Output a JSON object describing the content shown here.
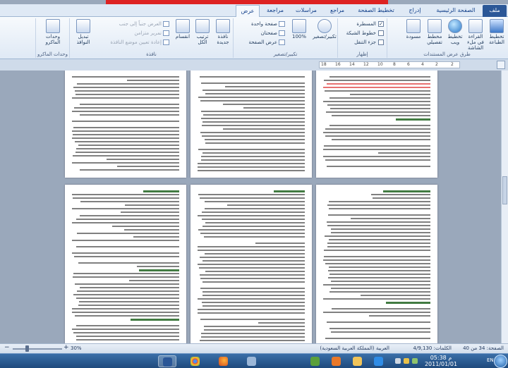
{
  "tabs": [
    {
      "id": "file",
      "label": "ملف"
    },
    {
      "id": "home",
      "label": "الصفحة الرئيسية"
    },
    {
      "id": "insert",
      "label": "إدراج"
    },
    {
      "id": "layout",
      "label": "تخطيط الصفحة"
    },
    {
      "id": "references",
      "label": "مراجع"
    },
    {
      "id": "mailings",
      "label": "مراسلات"
    },
    {
      "id": "review",
      "label": "مراجعة"
    },
    {
      "id": "view",
      "label": "عرض"
    }
  ],
  "ribbon": {
    "views": {
      "print": "تخطيط الطباعة",
      "fullscreen": "القراءة في ملء الشاشة",
      "web": "تخطيط ويب",
      "outline": "مخطط تفصيلي",
      "draft": "مسودة",
      "label": "طرق عرض المستندات"
    },
    "show": {
      "ruler": "المسطرة",
      "ruler_mark": "✓",
      "gridlines": "خطوط الشبكة",
      "nav": "جزء التنقل",
      "label": "إظهار"
    },
    "zoom": {
      "zoom": "تكبير/تصغير",
      "hundred": "100%",
      "one_page": "صفحة واحدة",
      "two_pages": "صفحتان",
      "page_width": "عرض الصفحة",
      "label": "تكبير/تصغير"
    },
    "window": {
      "new_window": "نافذة جديدة",
      "arrange": "ترتيب الكل",
      "split": "انقسام",
      "side_by_side": "العرض جنباً إلى جنب",
      "sync_scroll": "تمرير متزامن",
      "reset_pos": "إعادة تعيين موضع النافذة",
      "switch": "تبديل النوافذ",
      "label": "نافذة"
    },
    "macros": {
      "macros": "وحدات الماكرو",
      "label": "وحدات الماكرو"
    }
  },
  "ruler": {
    "ticks": [
      "18",
      "16",
      "14",
      "12",
      "10",
      "8",
      "6",
      "4",
      "2",
      "2"
    ]
  },
  "status": {
    "page": "الصفحة: 34 من 40",
    "words": "الكلمات: 4/9,130",
    "language": "العربية (المملكة العربية السعودية)",
    "zoom": "30%"
  },
  "taskbar": {
    "time": "05:38 م",
    "date": "2011/01/01",
    "lang": "EN"
  },
  "colors": {
    "accent": "#2b5797",
    "red_bar": "#dd2222"
  }
}
